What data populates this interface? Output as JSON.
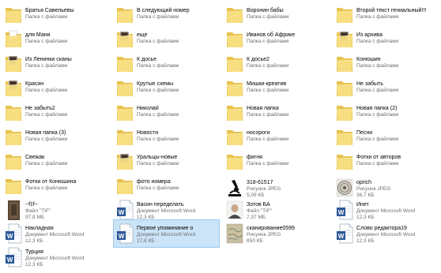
{
  "items": [
    {
      "name": "Братья Савельевы",
      "type": "Папка с файлами",
      "size": "",
      "icon": "folder-icon"
    },
    {
      "name": "В следующий номер",
      "type": "Папка с файлами",
      "size": "",
      "icon": "folder-icon"
    },
    {
      "name": "Воронин бабы",
      "type": "Папка с файлами",
      "size": "",
      "icon": "folder-icon"
    },
    {
      "name": "Второй текст гениальный!!!",
      "type": "Папка с файлами",
      "size": "",
      "icon": "folder-icon"
    },
    {
      "name": "для Мани",
      "type": "Папка с файлами",
      "size": "",
      "icon": "folder-with-paper-icon"
    },
    {
      "name": "еще",
      "type": "Папка с файлами",
      "size": "",
      "icon": "folder-with-photo-icon"
    },
    {
      "name": "Иванов об Африке",
      "type": "Папка с файлами",
      "size": "",
      "icon": "folder-icon"
    },
    {
      "name": "Из архива",
      "type": "Папка с файлами",
      "size": "",
      "icon": "folder-with-photo-icon"
    },
    {
      "name": "Из Ленинки сканы",
      "type": "Папка с файлами",
      "size": "",
      "icon": "folder-with-photo-icon"
    },
    {
      "name": "К досье",
      "type": "Папка с файлами",
      "size": "",
      "icon": "folder-icon"
    },
    {
      "name": "К досье2",
      "type": "Папка с файлами",
      "size": "",
      "icon": "folder-icon"
    },
    {
      "name": "Конюшин",
      "type": "Папка с файлами",
      "size": "",
      "icon": "folder-icon"
    },
    {
      "name": "Красин",
      "type": "Папка с файлами",
      "size": "",
      "icon": "folder-with-photo-icon"
    },
    {
      "name": "Крутые схемы",
      "type": "Папка с файлами",
      "size": "",
      "icon": "folder-icon"
    },
    {
      "name": "Мишки-креатив",
      "type": "Папка с файлами",
      "size": "",
      "icon": "folder-icon"
    },
    {
      "name": "Не забыть",
      "type": "Папка с файлами",
      "size": "",
      "icon": "folder-icon"
    },
    {
      "name": "Не забыть2",
      "type": "Папка с файлами",
      "size": "",
      "icon": "folder-icon"
    },
    {
      "name": "Николай",
      "type": "Папка с файлами",
      "size": "",
      "icon": "folder-icon"
    },
    {
      "name": "Новая папка",
      "type": "Папка с файлами",
      "size": "",
      "icon": "folder-icon"
    },
    {
      "name": "Новая папка (2)",
      "type": "Папка с файлами",
      "size": "",
      "icon": "folder-icon"
    },
    {
      "name": "Новая папка (3)",
      "type": "Папка с файлами",
      "size": "",
      "icon": "folder-icon"
    },
    {
      "name": "Новости",
      "type": "Папка с файлами",
      "size": "",
      "icon": "folder-icon"
    },
    {
      "name": "носороги",
      "type": "Папка с файлами",
      "size": "",
      "icon": "folder-icon"
    },
    {
      "name": "Песни",
      "type": "Папка с файлами",
      "size": "",
      "icon": "folder-icon"
    },
    {
      "name": "Свежак",
      "type": "Папка с файлами",
      "size": "",
      "icon": "folder-icon"
    },
    {
      "name": "Уральцы-новые",
      "type": "Папка с файлами",
      "size": "",
      "icon": "folder-with-photo-icon"
    },
    {
      "name": "фигня",
      "type": "Папка с файлами",
      "size": "",
      "icon": "folder-icon"
    },
    {
      "name": "Фотки от авторов",
      "type": "Папка с файлами",
      "size": "",
      "icon": "folder-icon"
    },
    {
      "name": "Фотки от Конюшина",
      "type": "Папка с файлами",
      "size": "",
      "icon": "folder-icon"
    },
    {
      "name": "фото номера",
      "type": "Папка с файлами",
      "size": "",
      "icon": "folder-icon"
    },
    {
      "name": "318-61517",
      "type": "Рисунок JPEG",
      "size": "5,09 КБ",
      "icon": "microscope-image-icon"
    },
    {
      "name": "oprich",
      "type": "Рисунок JPEG",
      "size": "36,7 КБ",
      "icon": "seal-image-icon"
    },
    {
      "name": "~f‡f~",
      "type": "Файл \"TIF\"",
      "size": "97,8 МБ",
      "icon": "tif-image-icon"
    },
    {
      "name": "Васин переделать",
      "type": "Документ Microsoft Word",
      "size": "12,3 КБ",
      "icon": "word-document-icon"
    },
    {
      "name": "Зотов БА",
      "type": "Файл \"TIF\"",
      "size": "7,37 МБ",
      "icon": "portrait-image-icon"
    },
    {
      "name": "Инет",
      "type": "Документ Microsoft Word",
      "size": "12,3 КБ",
      "icon": "word-document-icon"
    },
    {
      "name": "Накладная",
      "type": "Документ Microsoft Word",
      "size": "12,3 КБ",
      "icon": "word-document-icon"
    },
    {
      "name": "Первое упоминание о",
      "type": "Документ Microsoft Word",
      "size": "17,8 КБ",
      "icon": "word-document-icon",
      "selected": true
    },
    {
      "name": "сканирование0599",
      "type": "Рисунок JPEG",
      "size": "850 КБ",
      "icon": "scan-image-icon"
    },
    {
      "name": "Слово редактора19",
      "type": "Документ Microsoft Word",
      "size": "12,3 КБ",
      "icon": "word-document-icon"
    },
    {
      "name": "Турция",
      "type": "Документ Microsoft Word",
      "size": "12,3 КБ",
      "icon": "word-document-icon"
    }
  ],
  "colors": {
    "folder_back": "#e8c34f",
    "folder_front": "#f8df83",
    "selection_bg": "#cce4f7",
    "selection_border": "#99c9ef",
    "word_blue": "#2b5797",
    "subtext": "#6d6d6d"
  }
}
